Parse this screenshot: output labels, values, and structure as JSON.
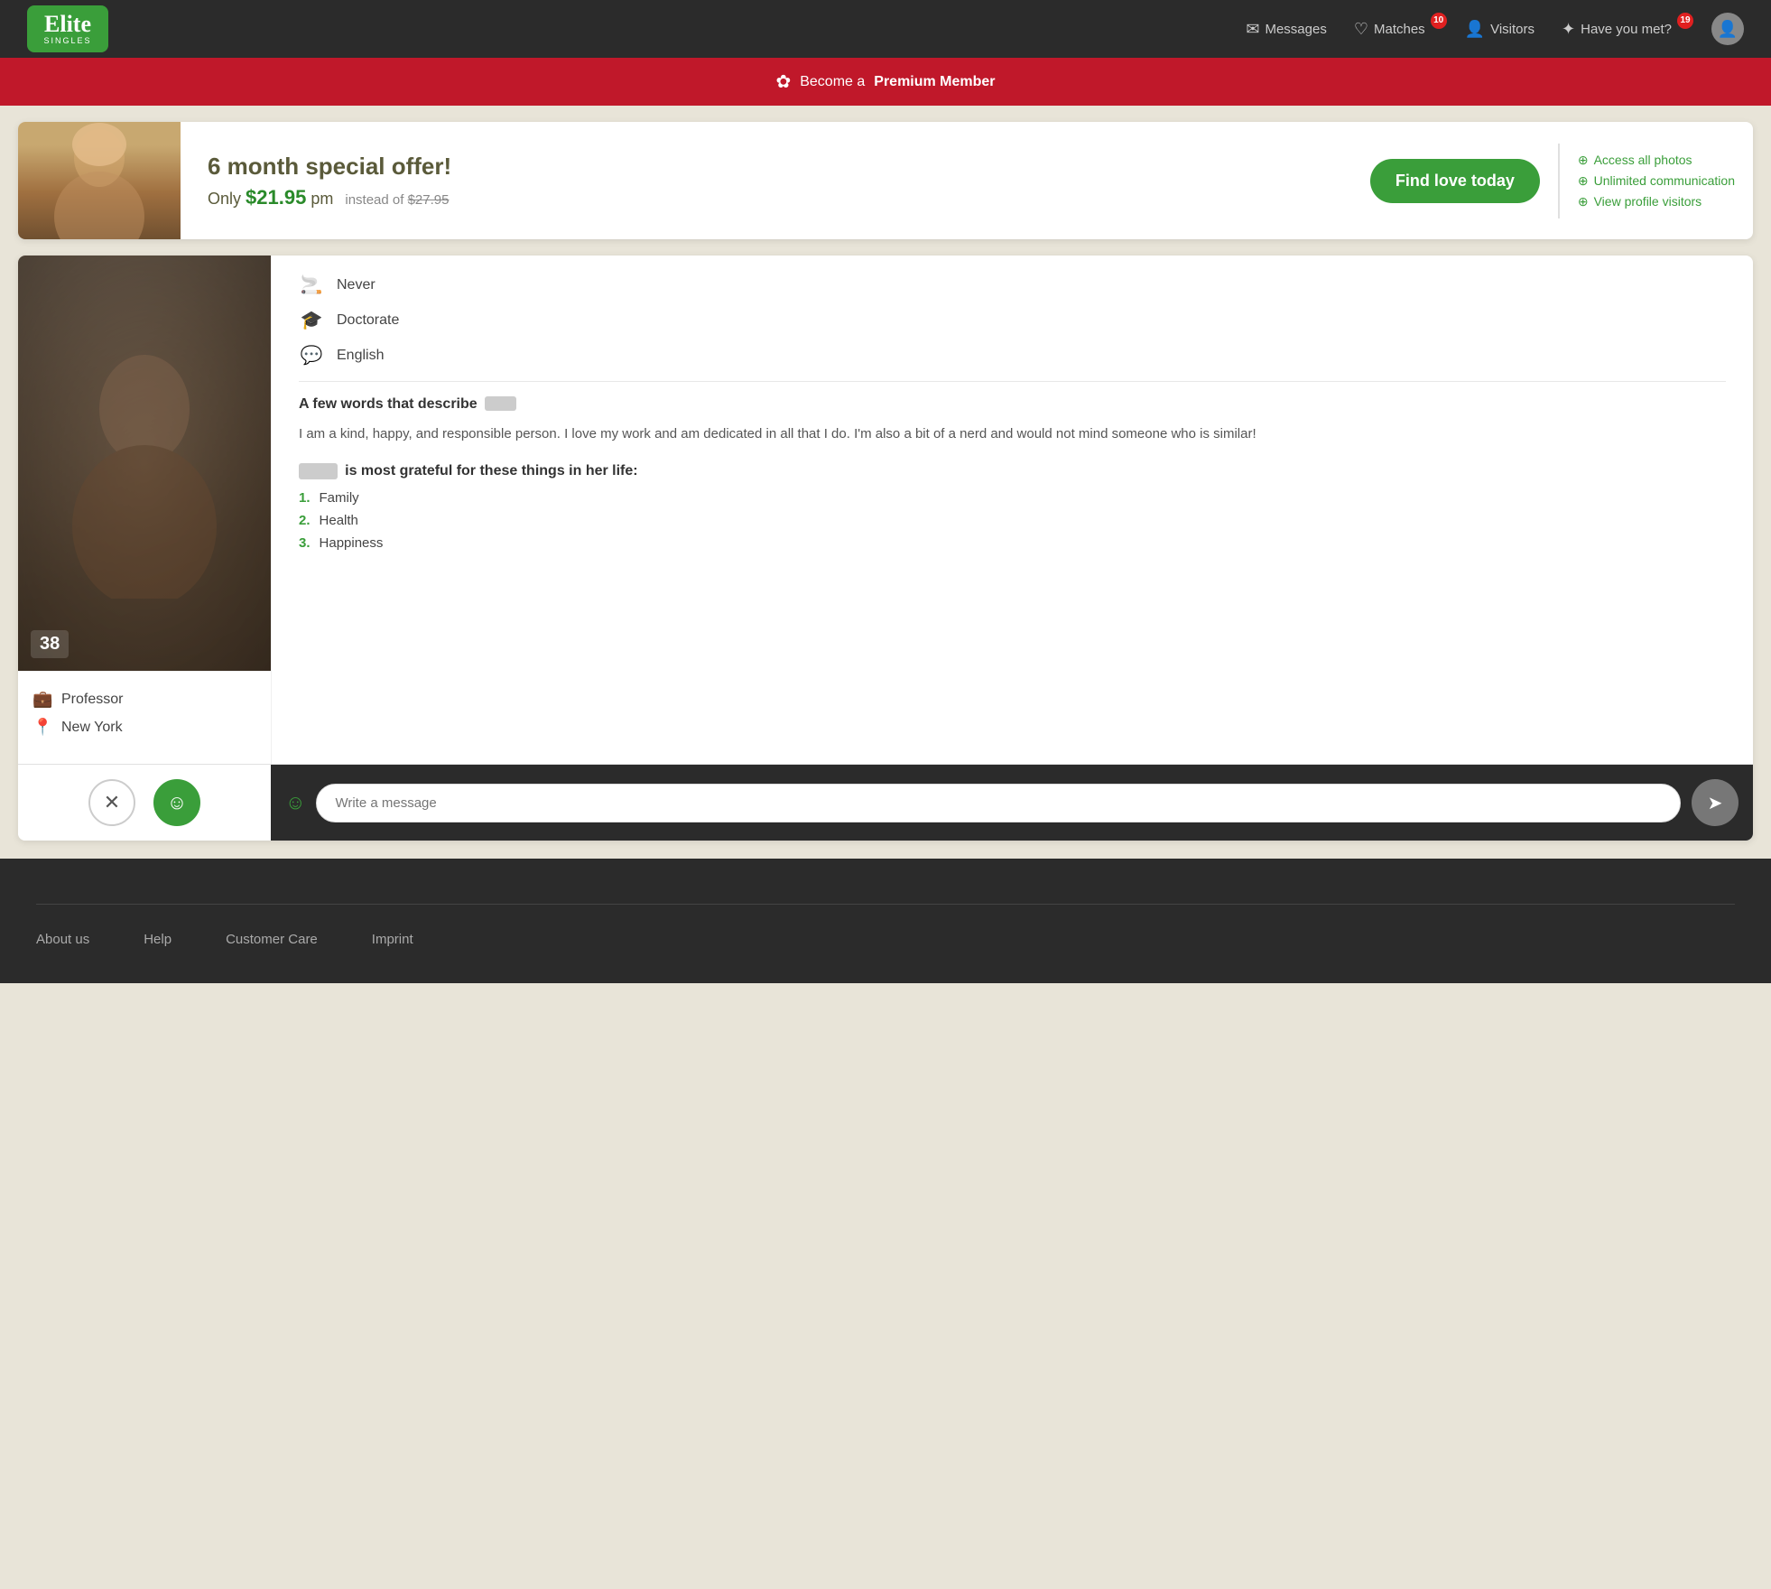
{
  "header": {
    "logo": "Elite",
    "logo_sub": "SINGLES",
    "nav": {
      "messages_label": "Messages",
      "matches_label": "Matches",
      "matches_badge": "10",
      "visitors_label": "Visitors",
      "have_you_met_label": "Have you met?",
      "have_you_met_badge": "19"
    }
  },
  "premium_bar": {
    "text_before": "Become a ",
    "text_bold": "Premium Member"
  },
  "offer": {
    "title": "6 month special offer!",
    "price_label": "Only ",
    "price": "$21.95",
    "price_unit": " pm",
    "price_old_label": "instead of ",
    "price_old": "$27.95",
    "cta_button": "Find love today",
    "features": [
      "Access all photos",
      "Unlimited communication",
      "View profile visitors"
    ]
  },
  "profile": {
    "age": "38",
    "job": "Professor",
    "location": "New York",
    "details": [
      {
        "icon": "smoking",
        "value": "Never"
      },
      {
        "icon": "education",
        "value": "Doctorate"
      },
      {
        "icon": "language",
        "value": "English"
      }
    ],
    "describe_section": "A few words that describe",
    "bio": "I am a kind, happy, and responsible person. I love my work and am dedicated in all that I do. I'm also a bit of a nerd and would not mind someone who is similar!",
    "grateful_title": "is most grateful for these things in her life:",
    "grateful_items": [
      "Family",
      "Health",
      "Happiness"
    ]
  },
  "message_input": {
    "placeholder": "Write a message"
  },
  "footer": {
    "links": [
      "About us",
      "Help",
      "Customer Care",
      "Imprint"
    ]
  }
}
